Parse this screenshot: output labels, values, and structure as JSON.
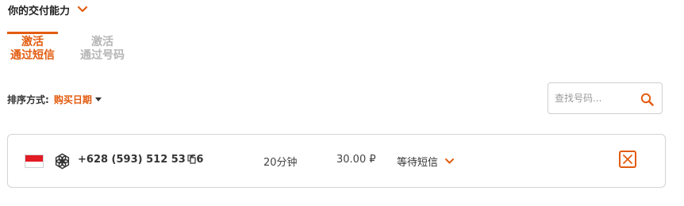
{
  "header": {
    "title": "你的交付能力",
    "chevron_icon": "chevron-down-icon"
  },
  "tabs": [
    {
      "line1": "激活",
      "line2": "通过短信",
      "active": true
    },
    {
      "line1": "激活",
      "line2": "通过号码",
      "active": false
    }
  ],
  "sort": {
    "label": "排序方式:",
    "value": "购买日期",
    "caret_icon": "caret-down-icon"
  },
  "search": {
    "placeholder": "查找号码...",
    "icon": "search-icon"
  },
  "order": {
    "flag_icon": "indonesia-flag-icon",
    "service_icon": "openai-icon",
    "phone": "+628 (593) 512 53 66",
    "copy_icon": "copy-icon",
    "duration": "20分钟",
    "price": "30.00 ₽",
    "status": "等待短信",
    "cancel_icon": "close-icon"
  },
  "colors": {
    "accent": "#e35b0f",
    "inactive": "#b5b5b5",
    "border": "#d4d4d4"
  }
}
